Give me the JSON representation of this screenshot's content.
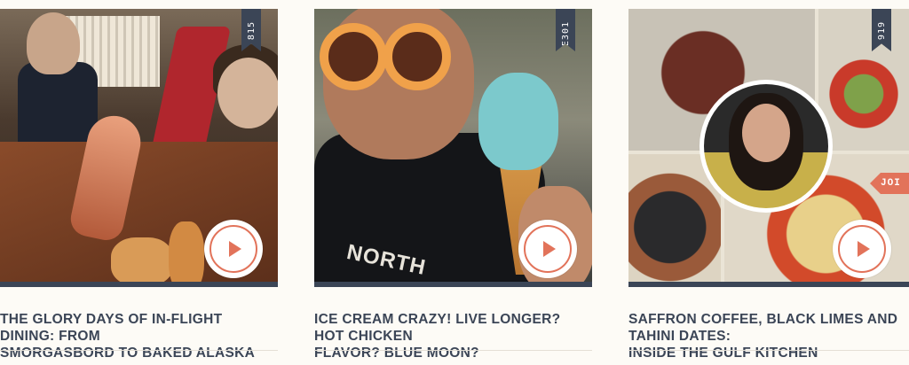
{
  "cards": [
    {
      "episode": "815",
      "title_line1": "THE GLORY DAYS OF IN-FLIGHT DINING: FROM",
      "title_line2": "SMORGASBORD TO BAKED ALASKA",
      "image_icon": "airline-dining-photo"
    },
    {
      "episode": "E301",
      "title_line1": "ICE CREAM CRAZY! LIVE LONGER? HOT CHICKEN",
      "title_line2": "FLAVOR? BLUE MOON?",
      "image_icon": "child-ice-cream-photo",
      "shirt_text": "NORTH"
    },
    {
      "episode": "919",
      "title_line1": "SAFFRON COFFEE, BLACK LIMES AND TAHINI DATES:",
      "title_line2": "INSIDE THE GULF KITCHEN",
      "image_icon": "gulf-kitchen-collage",
      "tag_label": "JOI"
    }
  ],
  "colors": {
    "navy": "#3b4556",
    "accent": "#e2735a",
    "background": "#fdfbf6"
  }
}
